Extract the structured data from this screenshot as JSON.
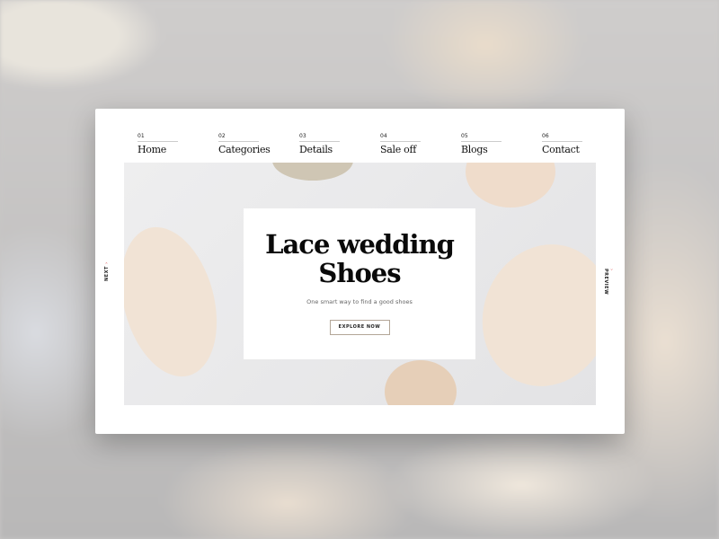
{
  "nav": [
    {
      "num": "01",
      "label": "Home"
    },
    {
      "num": "02",
      "label": "Categories"
    },
    {
      "num": "03",
      "label": "Details"
    },
    {
      "num": "04",
      "label": "Sale off"
    },
    {
      "num": "05",
      "label": "Blogs"
    },
    {
      "num": "06",
      "label": "Contact"
    }
  ],
  "hero": {
    "title_line1": "Lace wedding",
    "title_line2": "Shoes",
    "subtitle": "One smart way to find a good shoes",
    "cta": "EXPLORE NOW"
  },
  "side": {
    "next": "NEXT",
    "preview": "PREVIEW",
    "arrow": "›"
  }
}
